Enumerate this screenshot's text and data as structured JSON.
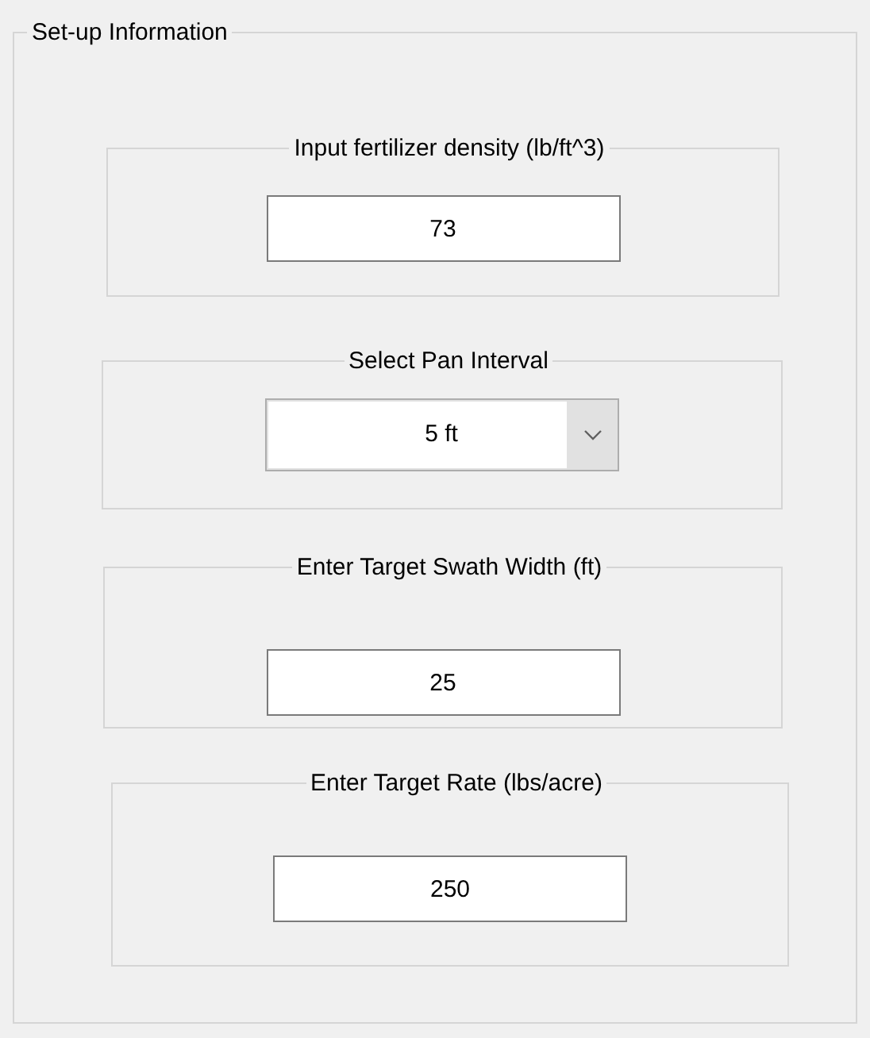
{
  "group": {
    "title": "Set-up Information"
  },
  "panels": [
    {
      "kind": "text",
      "title": "Input fertilizer density (lb/ft^3)",
      "value": "73"
    },
    {
      "kind": "dropdown",
      "title": "Select Pan Interval",
      "value": "5 ft"
    },
    {
      "kind": "text",
      "title": "Enter Target Swath Width (ft)",
      "value": "25"
    },
    {
      "kind": "text",
      "title": "Enter Target Rate (lbs/acre)",
      "value": "250"
    }
  ]
}
